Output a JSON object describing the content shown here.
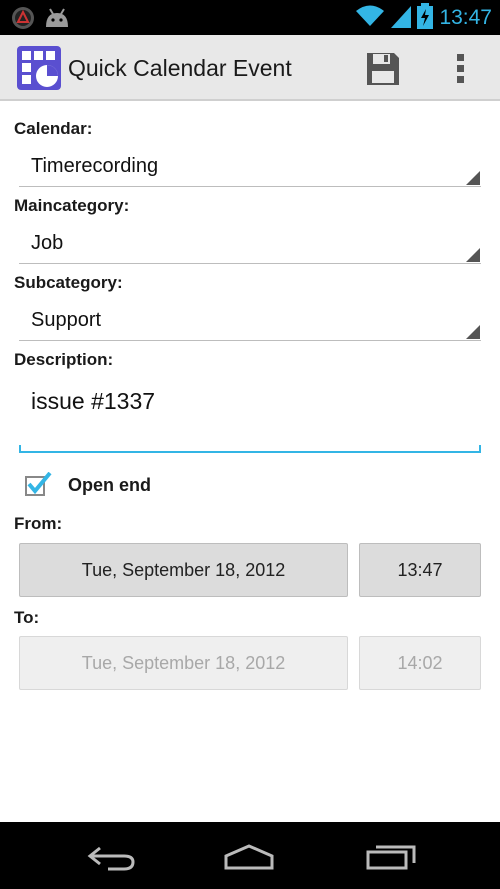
{
  "status": {
    "time": "13:47"
  },
  "app": {
    "title": "Quick Calendar Event"
  },
  "form": {
    "calendar": {
      "label": "Calendar:",
      "value": "Timerecording"
    },
    "maincategory": {
      "label": "Maincategory:",
      "value": "Job"
    },
    "subcategory": {
      "label": "Subcategory:",
      "value": "Support"
    },
    "description": {
      "label": "Description:",
      "value": "issue #1337"
    },
    "open_end": {
      "label": "Open end",
      "checked": true
    },
    "from": {
      "label": "From:",
      "date": "Tue, September 18, 2012",
      "time": "13:47"
    },
    "to": {
      "label": "To:",
      "date": "Tue, September 18, 2012",
      "time": "14:02"
    }
  },
  "colors": {
    "accent": "#33b5e5",
    "actionbar": "#e8e8e8",
    "statusbar": "#000000"
  },
  "icons": [
    "notification-icon",
    "android-icon",
    "wifi-icon",
    "signal-icon",
    "battery-icon",
    "app-calendar-icon",
    "save-icon",
    "overflow-menu-icon",
    "back-icon",
    "home-icon",
    "recents-icon"
  ]
}
